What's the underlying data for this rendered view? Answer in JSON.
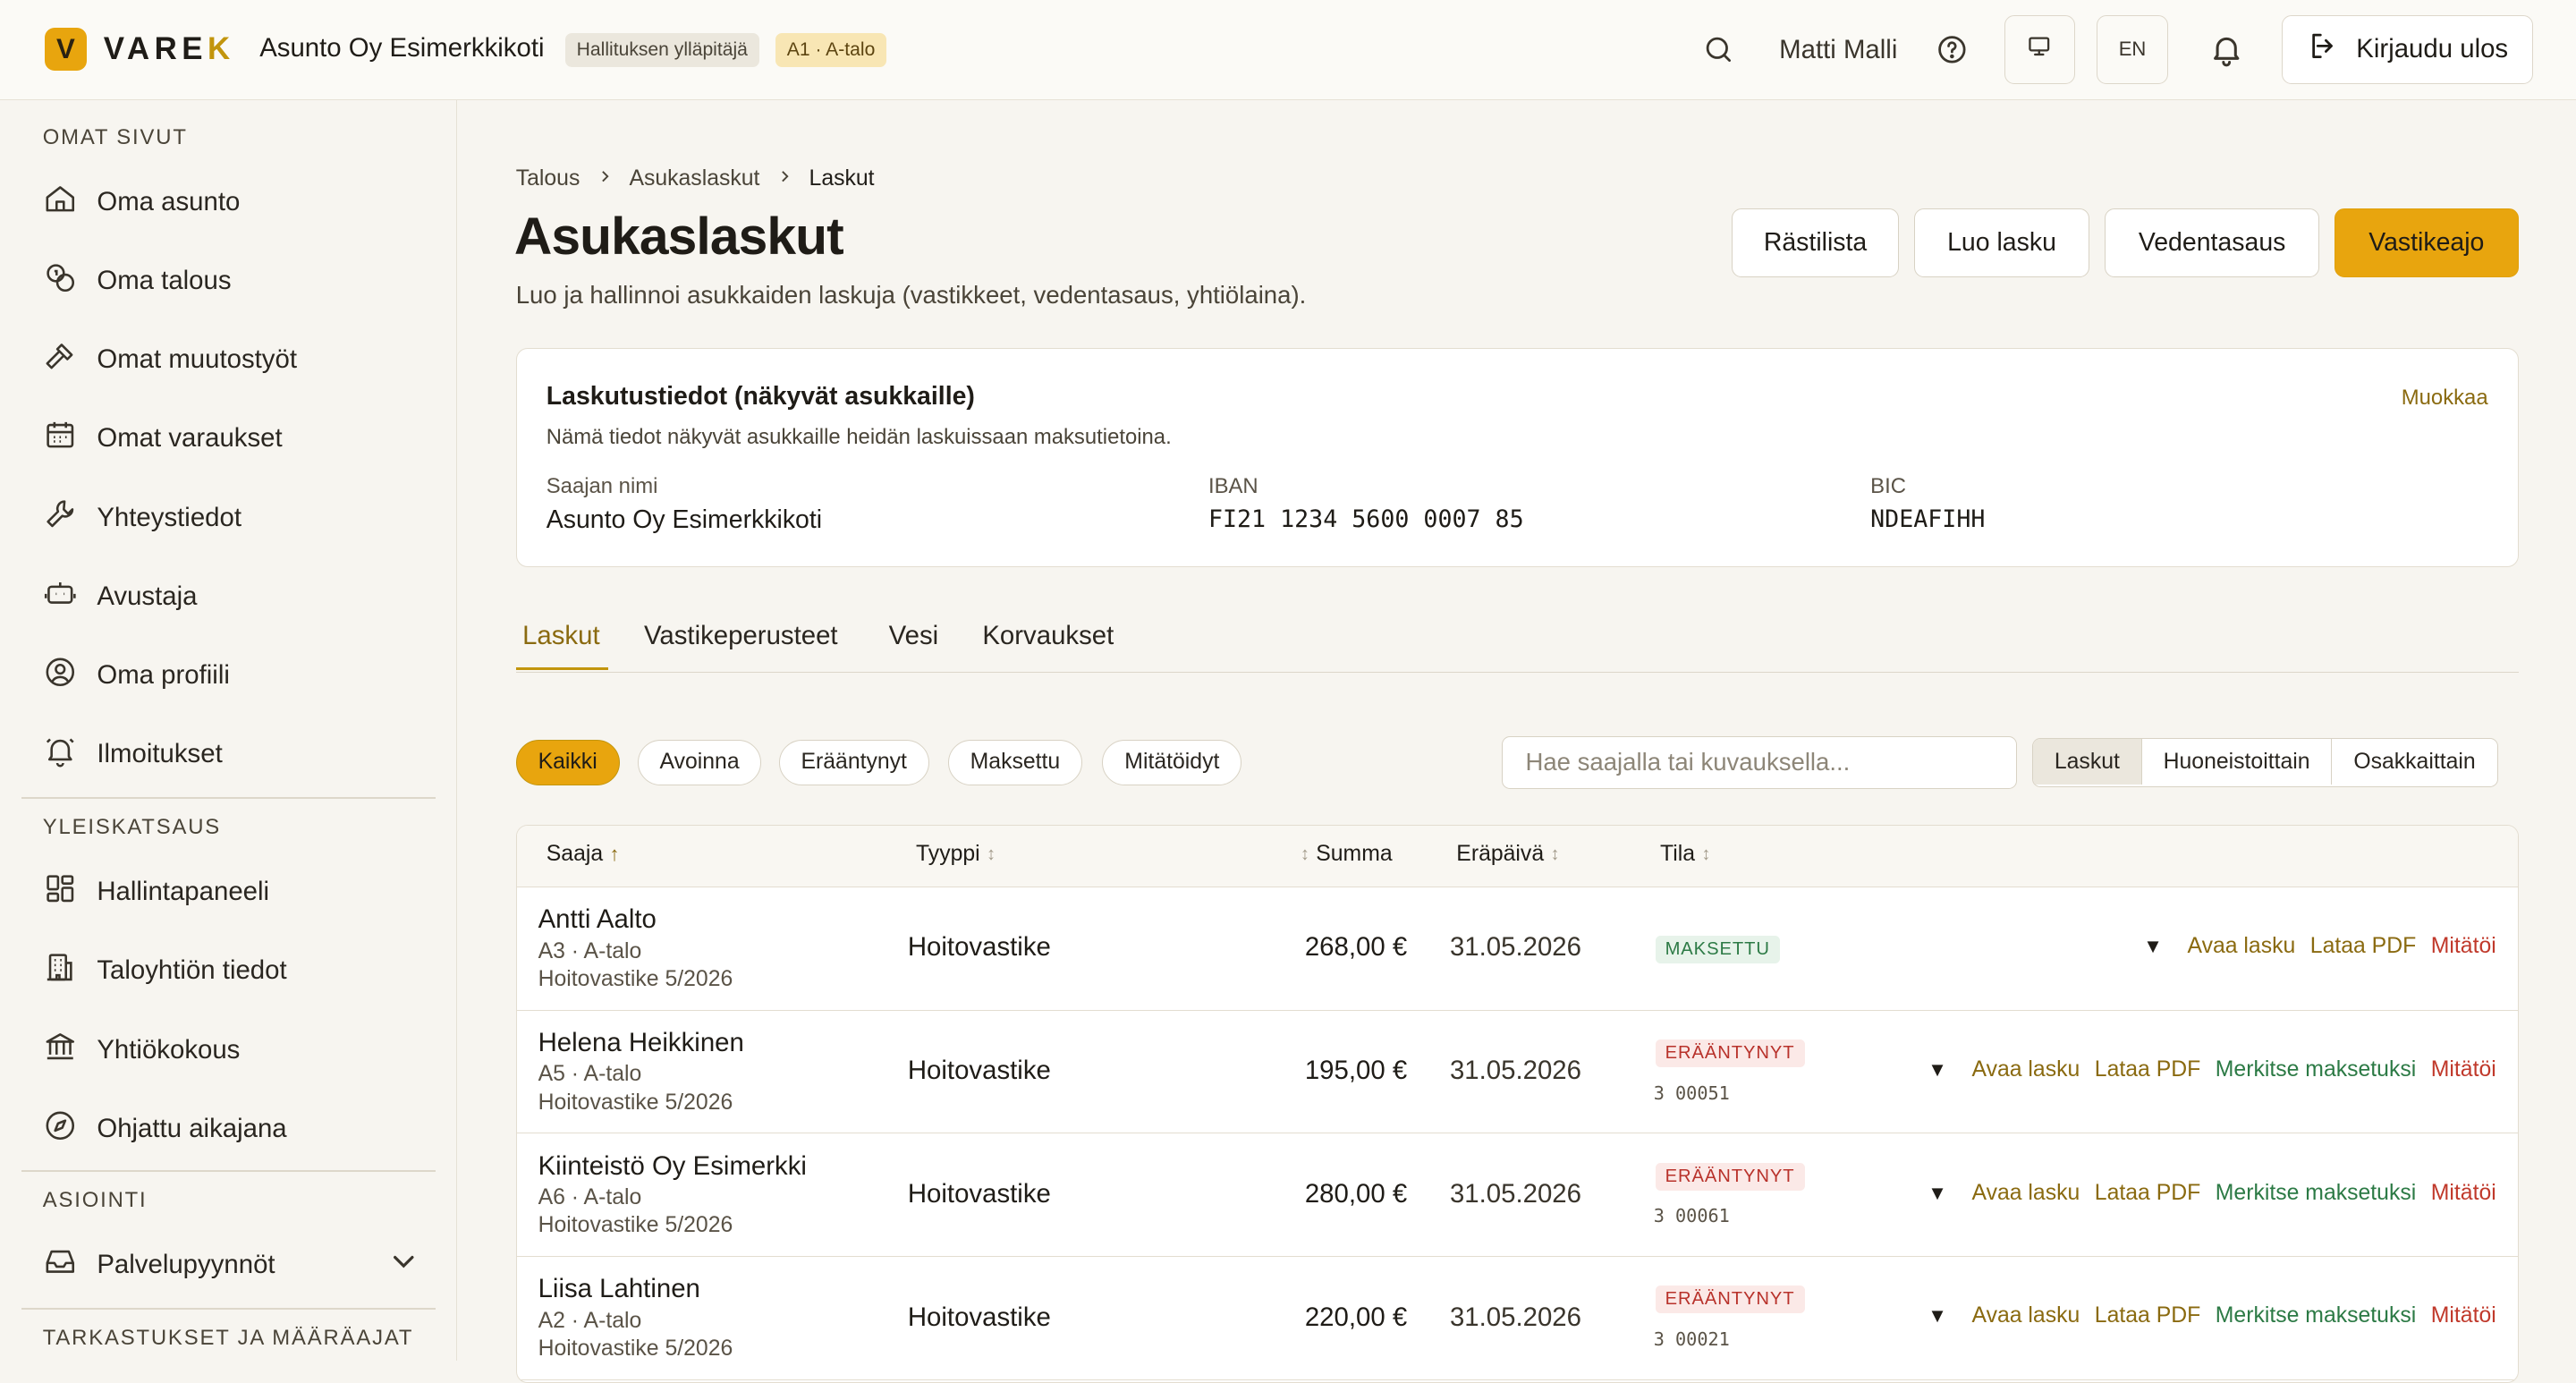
{
  "header": {
    "logo_letter": "V",
    "logo_text_main": "VARE",
    "logo_text_accent": "K",
    "org_name": "Asunto Oy Esimerkkikoti",
    "role_badge": "Hallituksen ylläpitäjä",
    "unit_badge": "A1 · A-talo",
    "user_name": "Matti Malli",
    "lang_button": "EN",
    "logout_label": "Kirjaudu ulos",
    "accent_color": "#e8a50e"
  },
  "sidebar": {
    "sections": [
      {
        "title": "OMAT SIVUT",
        "items": [
          {
            "label": "Oma asunto",
            "icon": "home-icon"
          },
          {
            "label": "Oma talous",
            "icon": "coins-icon"
          },
          {
            "label": "Omat muutostyöt",
            "icon": "hammer-icon"
          },
          {
            "label": "Omat varaukset",
            "icon": "calendar-icon"
          },
          {
            "label": "Yhteystiedot",
            "icon": "wrench-icon"
          },
          {
            "label": "Avustaja",
            "icon": "bot-icon"
          },
          {
            "label": "Oma profiili",
            "icon": "user-circle-icon"
          },
          {
            "label": "Ilmoitukset",
            "icon": "bell-icon"
          }
        ]
      },
      {
        "title": "YLEISKATSAUS",
        "items": [
          {
            "label": "Hallintapaneeli",
            "icon": "dashboard-icon"
          },
          {
            "label": "Taloyhtiön tiedot",
            "icon": "building-icon"
          },
          {
            "label": "Yhtiökokous",
            "icon": "landmark-icon"
          },
          {
            "label": "Ohjattu aikajana",
            "icon": "compass-icon"
          }
        ]
      },
      {
        "title": "ASIOINTI",
        "items": [
          {
            "label": "Palvelupyynnöt",
            "icon": "inbox-icon"
          }
        ]
      },
      {
        "title": "TARKASTUKSET JA MÄÄRÄAJAT",
        "items": []
      }
    ]
  },
  "breadcrumb": [
    "Talous",
    "Asukaslaskut",
    "Laskut"
  ],
  "page": {
    "title": "Asukaslaskut",
    "subtitle": "Luo ja hallinnoi asukkaiden laskuja (vastikkeet, vedentasaus, yhtiölaina).",
    "actions": [
      "Rästilista",
      "Luo lasku",
      "Vedentasaus",
      "Vastikeajo"
    ]
  },
  "billing_info": {
    "title": "Laskutustiedot (näkyvät asukkaille)",
    "description": "Nämä tiedot näkyvät asukkaille heidän laskuissaan maksutietoina.",
    "edit_label": "Muokkaa",
    "recipient_label": "Saajan nimi",
    "recipient_value": "Asunto Oy Esimerkkikoti",
    "iban_label": "IBAN",
    "iban_value": "FI21 1234 5600 0007 85",
    "bic_label": "BIC",
    "bic_value": "NDEAFIHH"
  },
  "tabs": [
    "Laskut",
    "Vastikeperusteet",
    "Vesi",
    "Korvaukset"
  ],
  "filters": {
    "chips": [
      "Kaikki",
      "Avoinna",
      "Erääntynyt",
      "Maksettu",
      "Mitätöidyt"
    ],
    "search_placeholder": "Hae saajalla tai kuvauksella...",
    "view_modes": [
      "Laskut",
      "Huoneistoittain",
      "Osakkaittain"
    ]
  },
  "table": {
    "columns": [
      "Saaja",
      "Tyyppi",
      "Summa",
      "Eräpäivä",
      "Tila"
    ],
    "action_labels": {
      "open": "Avaa lasku",
      "pdf": "Lataa PDF",
      "mark_paid": "Merkitse maksetuksi",
      "void": "Mitätöi"
    },
    "rows": [
      {
        "name": "Antti Aalto",
        "unit": "A3 · A-talo",
        "desc": "Hoitovastike 5/2026",
        "type": "Hoitovastike",
        "sum": "268,00 €",
        "due": "31.05.2026",
        "status": "MAKSETTU",
        "ref": ""
      },
      {
        "name": "Helena Heikkinen",
        "unit": "A5 · A-talo",
        "desc": "Hoitovastike 5/2026",
        "type": "Hoitovastike",
        "sum": "195,00 €",
        "due": "31.05.2026",
        "status": "ERÄÄNTYNYT",
        "ref": "3 00051"
      },
      {
        "name": "Kiinteistö Oy Esimerkki",
        "unit": "A6 · A-talo",
        "desc": "Hoitovastike 5/2026",
        "type": "Hoitovastike",
        "sum": "280,00 €",
        "due": "31.05.2026",
        "status": "ERÄÄNTYNYT",
        "ref": "3 00061"
      },
      {
        "name": "Liisa Lahtinen",
        "unit": "A2 · A-talo",
        "desc": "Hoitovastike 5/2026",
        "type": "Hoitovastike",
        "sum": "220,00 €",
        "due": "31.05.2026",
        "status": "ERÄÄNTYNYT",
        "ref": "3 00021"
      }
    ]
  }
}
